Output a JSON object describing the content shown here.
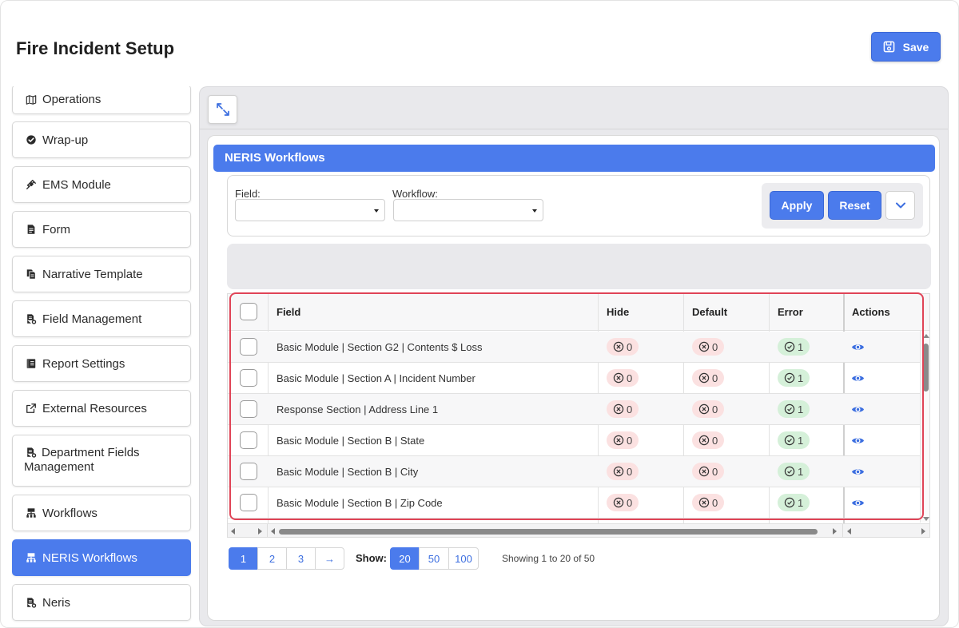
{
  "page": {
    "title": "Fire Incident Setup",
    "save_label": "Save"
  },
  "sidebar": {
    "items": [
      {
        "label": "Operations",
        "icon": "map-icon"
      },
      {
        "label": "Wrap-up",
        "icon": "check-circle-icon"
      },
      {
        "label": "EMS Module",
        "icon": "syringe-icon"
      },
      {
        "label": "Form",
        "icon": "document-icon"
      },
      {
        "label": "Narrative Template",
        "icon": "copy-icon"
      },
      {
        "label": "Field Management",
        "icon": "file-gear-icon"
      },
      {
        "label": "Report Settings",
        "icon": "book-icon"
      },
      {
        "label": "External Resources",
        "icon": "external-link-icon"
      },
      {
        "label": "Department Fields Management",
        "icon": "file-gear-icon"
      },
      {
        "label": "Workflows",
        "icon": "sitemap-icon"
      },
      {
        "label": "NERIS Workflows",
        "icon": "sitemap-icon",
        "active": true
      },
      {
        "label": "Neris",
        "icon": "file-gear-icon"
      }
    ]
  },
  "card": {
    "title": "NERIS Workflows"
  },
  "filters": {
    "field_label": "Field:",
    "field_value": "",
    "workflow_label": "Workflow:",
    "workflow_value": "",
    "apply_label": "Apply",
    "reset_label": "Reset"
  },
  "table": {
    "columns": [
      "Field",
      "Hide",
      "Default",
      "Error",
      "Actions"
    ],
    "rows": [
      {
        "field": "Basic Module | Section G2 | Contents $ Loss",
        "hide": "0",
        "default": "0",
        "error": "1"
      },
      {
        "field": "Basic Module | Section A | Incident Number",
        "hide": "0",
        "default": "0",
        "error": "1"
      },
      {
        "field": "Response Section | Address Line 1",
        "hide": "0",
        "default": "0",
        "error": "1"
      },
      {
        "field": "Basic Module | Section B | State",
        "hide": "0",
        "default": "0",
        "error": "1"
      },
      {
        "field": "Basic Module | Section B | City",
        "hide": "0",
        "default": "0",
        "error": "1"
      },
      {
        "field": "Basic Module | Section B | Zip Code",
        "hide": "0",
        "default": "0",
        "error": "1"
      }
    ]
  },
  "pagination": {
    "pages": [
      "1",
      "2",
      "3",
      "→"
    ],
    "current_page": "1",
    "show_label": "Show:",
    "sizes": [
      "20",
      "50",
      "100"
    ],
    "current_size": "20",
    "summary": "Showing 1 to 20 of 50"
  },
  "colors": {
    "accent": "#4b7bec",
    "highlight": "#e04457",
    "error_pill": "#fbe1e1",
    "ok_pill": "#d5f0d9"
  }
}
